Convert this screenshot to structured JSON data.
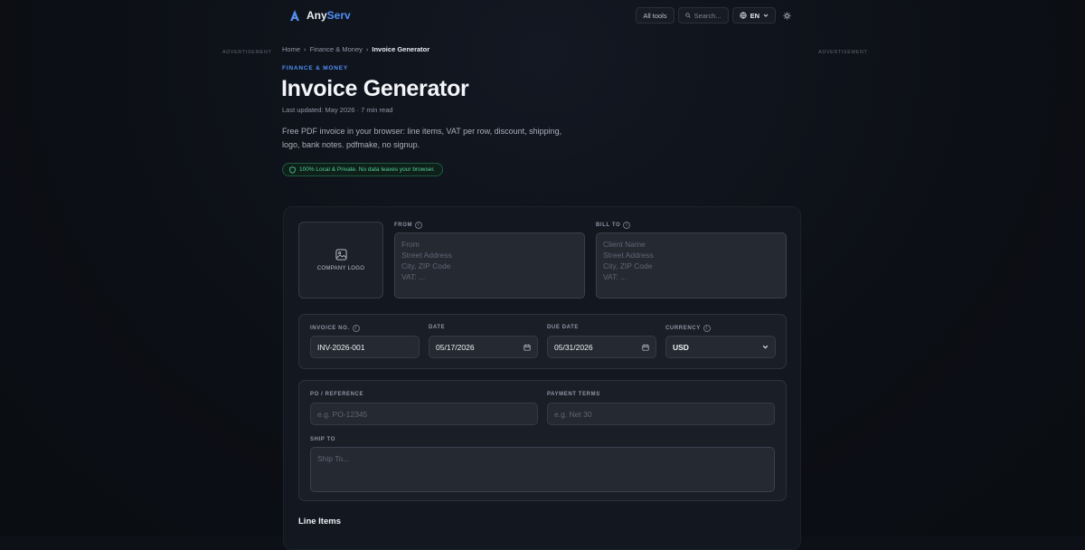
{
  "header": {
    "brand_any": "Any",
    "brand_serv": "Serv",
    "all_tools": "All tools",
    "search_placeholder": "Search...",
    "lang": "EN",
    "accent": "#4f8ff7"
  },
  "ads": {
    "left": "ADVERTISEMENT",
    "right": "ADVERTISEMENT"
  },
  "breadcrumb": {
    "home": "Home",
    "category": "Finance & Money",
    "current": "Invoice Generator",
    "sep": "›"
  },
  "hero": {
    "kicker": "FINANCE & MONEY",
    "title": "Invoice Generator",
    "updated": "Last updated: May 2026 · 7 min read",
    "intro": "Free PDF invoice in your browser: line items, VAT per row, discount, shipping, logo, bank notes. pdfmake, no signup.",
    "privacy": "100% Local & Private. No data leaves your browser."
  },
  "form": {
    "logo_label": "COMPANY LOGO",
    "from_label": "FROM",
    "from_placeholder": "From\nStreet Address\nCity, ZIP Code\nVAT: ...",
    "bill_to_label": "BILL TO",
    "bill_to_placeholder": "Client Name\nStreet Address\nCity, ZIP Code\nVAT: ...",
    "invoice_no_label": "INVOICE NO.",
    "invoice_no_value": "INV-2026-001",
    "date_label": "DATE",
    "date_value": "05/17/2026",
    "due_date_label": "DUE DATE",
    "due_date_value": "05/31/2026",
    "currency_label": "CURRENCY",
    "currency_value": "USD",
    "po_label": "PO / REFERENCE",
    "po_placeholder": "e.g. PO-12345",
    "terms_label": "PAYMENT TERMS",
    "terms_placeholder": "e.g. Net 30",
    "ship_label": "SHIP TO",
    "ship_placeholder": "Ship To...",
    "line_items_title": "Line Items"
  }
}
